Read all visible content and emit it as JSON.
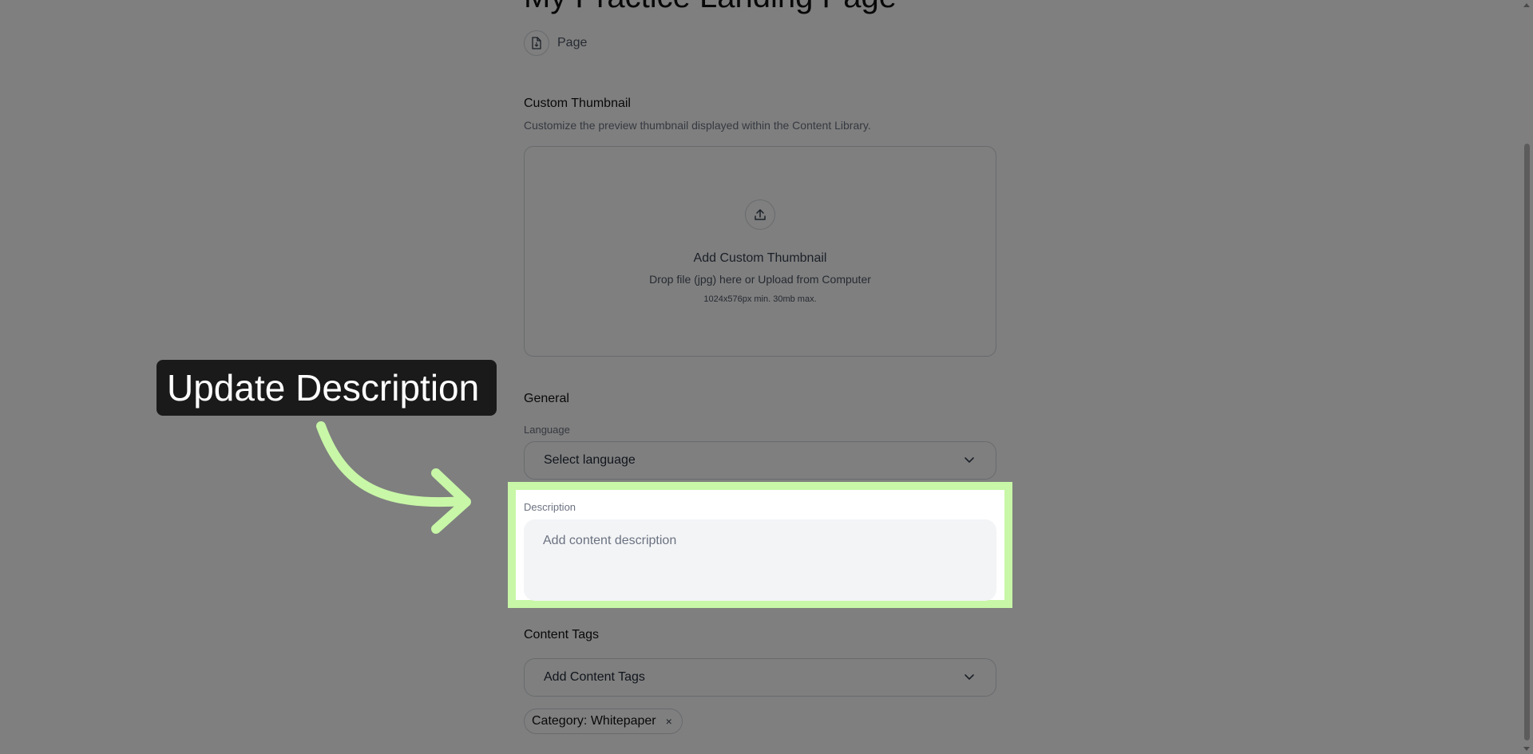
{
  "page": {
    "title": "My Practice Landing Page",
    "type_label": "Page"
  },
  "thumbnail": {
    "heading": "Custom Thumbnail",
    "subtitle": "Customize the preview thumbnail displayed within the Content Library.",
    "add_title": "Add Custom Thumbnail",
    "drop_text": "Drop file (jpg) here or Upload from Computer",
    "size_hint": "1024x576px min. 30mb max."
  },
  "general": {
    "heading": "General",
    "language_label": "Language",
    "language_value": "Select language",
    "description_label": "Description",
    "description_placeholder": "Add content description"
  },
  "tags": {
    "heading": "Content Tags",
    "select_value": "Add Content Tags",
    "chips": [
      {
        "label": "Category: Whitepaper",
        "remove": "×"
      }
    ]
  },
  "callout": {
    "text": "Update Description",
    "highlight_color": "#c8f7a7",
    "box_color": "#1a1a1a"
  },
  "icons": {
    "page_type": "file-icon",
    "upload": "upload-icon",
    "chevron": "chevron-down-icon"
  }
}
